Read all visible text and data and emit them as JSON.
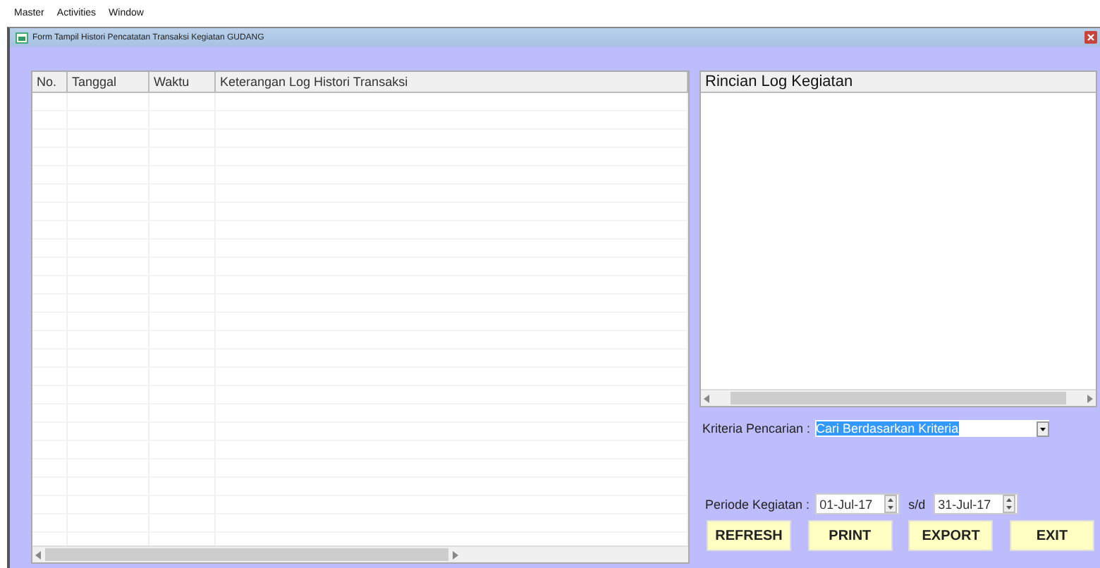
{
  "menu": [
    "Master",
    "Activities",
    "Window"
  ],
  "window": {
    "title": "Form Tampil Histori Pencatatan Transaksi Kegiatan GUDANG"
  },
  "table": {
    "columns": [
      "No.",
      "Tanggal",
      "Waktu",
      "Keterangan Log Histori Transaksi"
    ]
  },
  "detail_panel": {
    "title": "Rincian Log Kegiatan"
  },
  "criteria": {
    "label": "Kriteria Pencarian :",
    "value": "Cari Berdasarkan Kriteria"
  },
  "period": {
    "label": "Periode Kegiatan :",
    "from": "01-Jul-17",
    "separator": "s/d",
    "to": "31-Jul-17"
  },
  "buttons": [
    "REFRESH",
    "PRINT",
    "EXPORT",
    "EXIT"
  ]
}
